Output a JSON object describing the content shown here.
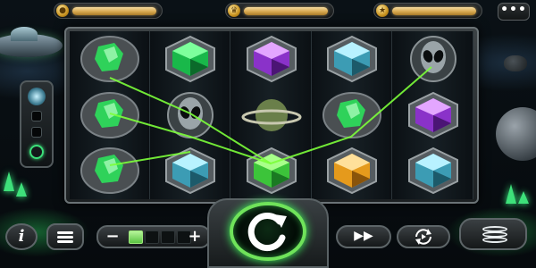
{
  "topbar": {
    "balance": {
      "icon": "coin-icon",
      "glyph": "●"
    },
    "bet": {
      "icon": "crown-icon",
      "glyph": "♛"
    },
    "win": {
      "icon": "star-icon",
      "glyph": "★"
    },
    "menu_label": "•••"
  },
  "reels": [
    [
      "green-rock-gem",
      "green-rock-gem",
      "green-rock-gem"
    ],
    [
      "emerald-gem",
      "alien-head",
      "cyan-gem"
    ],
    [
      "purple-gem",
      "ringed-planet",
      "green-gem"
    ],
    [
      "cyan-gem",
      "green-rock-gem",
      "amber-gem"
    ],
    [
      "alien-head",
      "purple-gem",
      "cyan-gem"
    ]
  ],
  "controls": {
    "info_label": "i",
    "bet_minus_label": "−",
    "bet_plus_label": "+",
    "bet_level": 1,
    "bet_levels": 4,
    "fast_forward_label": "▶▶"
  },
  "colors": {
    "accent_green": "#3ce07a",
    "gold": "#d4a44a",
    "payline": "#7cff3a"
  }
}
